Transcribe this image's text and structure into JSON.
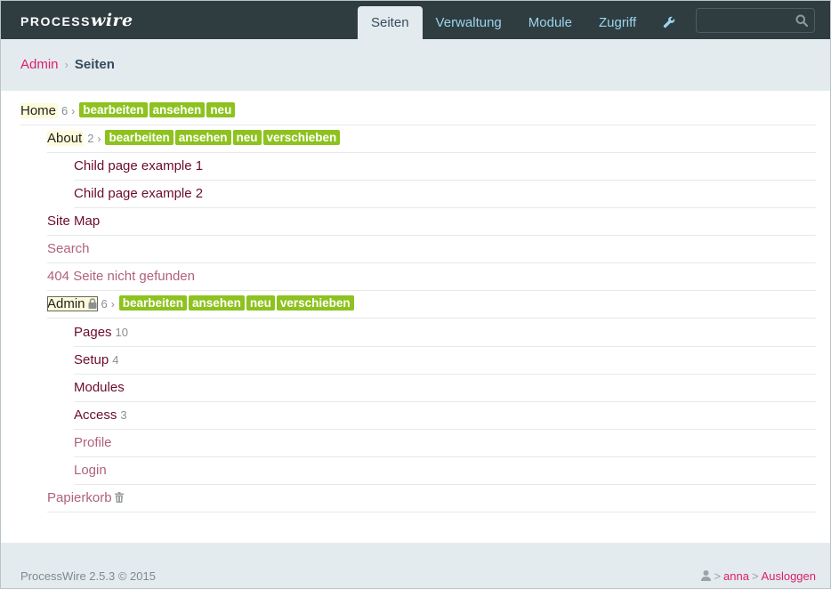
{
  "brand": {
    "logo_part1": "PROCESS",
    "logo_part2": "wire"
  },
  "topnav": {
    "tabs": [
      {
        "label": "Seiten",
        "active": true
      },
      {
        "label": "Verwaltung"
      },
      {
        "label": "Module"
      },
      {
        "label": "Zugriff"
      }
    ],
    "wrench_icon": "wrench-icon"
  },
  "search": {
    "value": "",
    "placeholder": "",
    "icon": "search-icon"
  },
  "breadcrumb": {
    "parent": "Admin",
    "separator": "›",
    "current": "Seiten"
  },
  "tree": {
    "arrow": "›",
    "rows": [
      {
        "label": "Home",
        "count": "6",
        "actions": [
          "bearbeiten",
          "ansehen",
          "neu"
        ]
      },
      {
        "label": "About",
        "count": "2",
        "actions": [
          "bearbeiten",
          "ansehen",
          "neu",
          "verschieben"
        ]
      },
      {
        "label": "Child page example 1"
      },
      {
        "label": "Child page example 2"
      },
      {
        "label": "Site Map"
      },
      {
        "label": "Search"
      },
      {
        "label": "404 Seite nicht gefunden"
      },
      {
        "label": "Admin",
        "count": "6",
        "icon": "lock-icon",
        "actions": [
          "bearbeiten",
          "ansehen",
          "neu",
          "verschieben"
        ]
      },
      {
        "label": "Pages",
        "count": "10"
      },
      {
        "label": "Setup",
        "count": "4"
      },
      {
        "label": "Modules"
      },
      {
        "label": "Access",
        "count": "3"
      },
      {
        "label": "Profile"
      },
      {
        "label": "Login"
      },
      {
        "label": "Papierkorb",
        "icon": "trash-icon"
      }
    ]
  },
  "footer": {
    "copyright": "ProcessWire 2.5.3 © 2015",
    "user_icon": "user-icon",
    "separator": ">",
    "username": "anna",
    "logout": "Ausloggen"
  },
  "colors": {
    "masthead": "#2f3d40",
    "accent_pink": "#dd1d6f",
    "action_green": "#8dc21f",
    "nav_link": "#9cd3ec",
    "page_link": "#6c0b2c"
  }
}
